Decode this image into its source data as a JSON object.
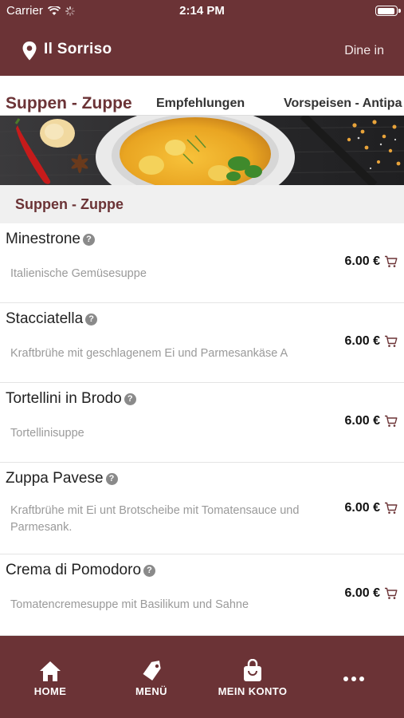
{
  "status_bar": {
    "carrier": "Carrier",
    "time": "2:14 PM"
  },
  "header": {
    "restaurant_name": "Il Sorriso",
    "mode": "Dine in"
  },
  "category_tabs": [
    {
      "label": "Suppen - Zuppe",
      "active": true
    },
    {
      "label": "Empfehlungen",
      "active": false
    },
    {
      "label": "Vorspeisen - Antipa",
      "active": false
    }
  ],
  "section": {
    "title": "Suppen - Zuppe"
  },
  "menu_items": [
    {
      "name": "Minestrone",
      "description": "Italienische Gemüsesuppe",
      "price": "6.00 €"
    },
    {
      "name": "Stacciatella",
      "description": "Kraftbrühe mit geschlagenem Ei und Parmesankäse A",
      "price": "6.00 €"
    },
    {
      "name": "Tortellini in Brodo",
      "description": "Tortellinisuppe",
      "price": "6.00 €"
    },
    {
      "name": "Zuppa Pavese",
      "description": "Kraftbrühe mit Ei unt Brotscheibe mit Tomatensauce und Parmesank.",
      "price": "6.00 €"
    },
    {
      "name": "Crema di Pomodoro",
      "description": "Tomatencremesuppe mit Basilikum und Sahne",
      "price": "6.00 €"
    }
  ],
  "bottom_nav": [
    {
      "label": "HOME",
      "icon": "home-icon"
    },
    {
      "label": "MENÜ",
      "icon": "tag-icon"
    },
    {
      "label": "MEIN KONTO",
      "icon": "bag-icon"
    },
    {
      "label": "",
      "icon": "more-icon"
    }
  ],
  "colors": {
    "brand": "#6b3336",
    "section_bg": "#f0f0f0",
    "muted_text": "#9a9a9a"
  }
}
